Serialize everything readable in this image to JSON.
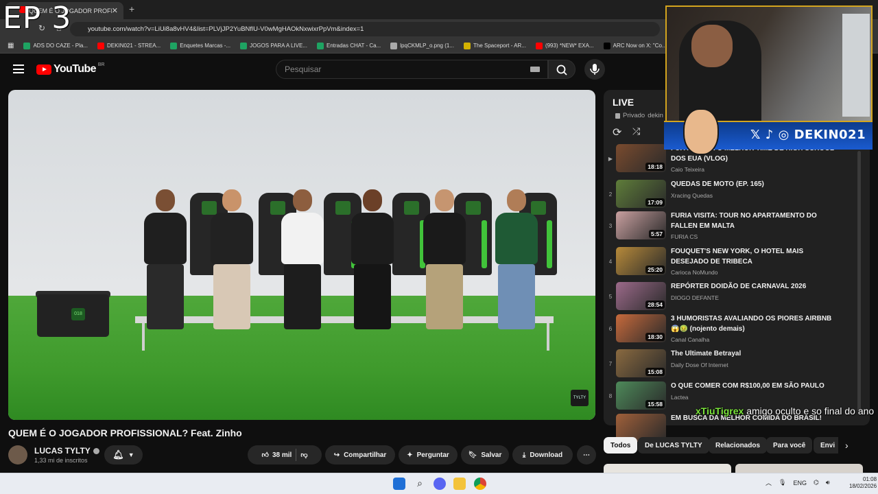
{
  "overlay": {
    "episode": "EP 3"
  },
  "browser": {
    "tab_title": "QUEM É O JOGADOR PROFISSIONAL?",
    "url": "youtube.com/watch?v=LiUi8a8vHV4&list=PLVjJP2YuBNflU-V0wMgHAOkNxwixrPpVm&index=1",
    "bookmarks": [
      {
        "label": "ADS DO CAZE - Pla...",
        "color": "#1ea362"
      },
      {
        "label": "DEKIN021 - STREA...",
        "color": "#ff0000"
      },
      {
        "label": "Enquetes Marcas -...",
        "color": "#1ea362"
      },
      {
        "label": "JOGOS PARA A LIVE...",
        "color": "#1ea362"
      },
      {
        "label": "Entradas CHAT - Ca...",
        "color": "#1ea362"
      },
      {
        "label": "lpqCKMLP_o.png (1...",
        "color": "#aaaaaa"
      },
      {
        "label": "The Spaceport - AR...",
        "color": "#d4b200"
      },
      {
        "label": "(993) *NEW* EXA...",
        "color": "#ff0000"
      },
      {
        "label": "ARC Now on X: \"Co...",
        "color": "#000000"
      }
    ]
  },
  "youtube": {
    "logo": "YouTube",
    "country": "BR",
    "search_placeholder": "Pesquisar",
    "video": {
      "title": "QUEM É O JOGADOR PROFISSIONAL? Feat. Zinho",
      "watermark": "TYLTY"
    },
    "channel": {
      "name": "LUCAS TYLTY",
      "subs": "1,33 mi de inscritos"
    },
    "actions": {
      "likes": "38 mil",
      "share": "Compartilhar",
      "ask": "Perguntar",
      "save": "Salvar",
      "download": "Download"
    },
    "playlist": {
      "title": "LIVE",
      "privacy": "Privado",
      "owner": "dekin",
      "items": [
        {
          "idx": "▶",
          "title": "FUI ASSISTIR O MELHOR TIME DE HIGH SCHOOL DOS EUA (VLOG)",
          "channel": "Caio Teixeira",
          "duration": "18:18",
          "color": "#7a4b2e"
        },
        {
          "idx": "2",
          "title": "QUEDAS DE MOTO (EP. 165)",
          "channel": "Xracing Quedas",
          "duration": "17:09",
          "color": "#5f7d3a"
        },
        {
          "idx": "3",
          "title": "FURIA VISITA: TOUR NO APARTAMENTO DO FALLEN EM MALTA",
          "channel": "FURIA CS",
          "duration": "5:57",
          "color": "#c9a0a0"
        },
        {
          "idx": "4",
          "title": "FOUQUET'S NEW YORK, O HOTEL MAIS DESEJADO DE TRIBECA",
          "channel": "Carioca NoMundo",
          "duration": "25:20",
          "color": "#b78a3a"
        },
        {
          "idx": "5",
          "title": "REPÓRTER DOIDÃO DE CARNAVAL 2026",
          "channel": "DIOGO DEFANTE",
          "duration": "28:54",
          "color": "#9c6a8a"
        },
        {
          "idx": "6",
          "title": "3 HUMORISTAS AVALIANDO OS PIORES AIRBNB 😱🤢 (nojento demais)",
          "channel": "Canal Canalha",
          "duration": "18:30",
          "color": "#c76a3c"
        },
        {
          "idx": "7",
          "title": "The Ultimate Betrayal",
          "channel": "Daily Dose Of Internet",
          "duration": "15:08",
          "color": "#8a6a40"
        },
        {
          "idx": "8",
          "title": "O QUE COMER COM R$100,00 EM SÃO PAULO",
          "channel": "Lactea",
          "duration": "15:58",
          "color": "#4e8a5a"
        },
        {
          "idx": "",
          "title": "EM BUSCA DA MELHOR COMIDA DO BRASIL!",
          "channel": "",
          "duration": "",
          "color": "#a0603a"
        }
      ]
    },
    "chips": [
      "Todos",
      "De LUCAS TYLTY",
      "Relacionados",
      "Para você",
      "Envi"
    ]
  },
  "chat": {
    "user": "xTiuTigrex",
    "message": "amigo oculto e so final do ano"
  },
  "stream_banner": {
    "handle": "DEKIN021"
  },
  "taskbar": {
    "lang": "ENG",
    "time": "01:08",
    "date": "18/02/2026"
  }
}
